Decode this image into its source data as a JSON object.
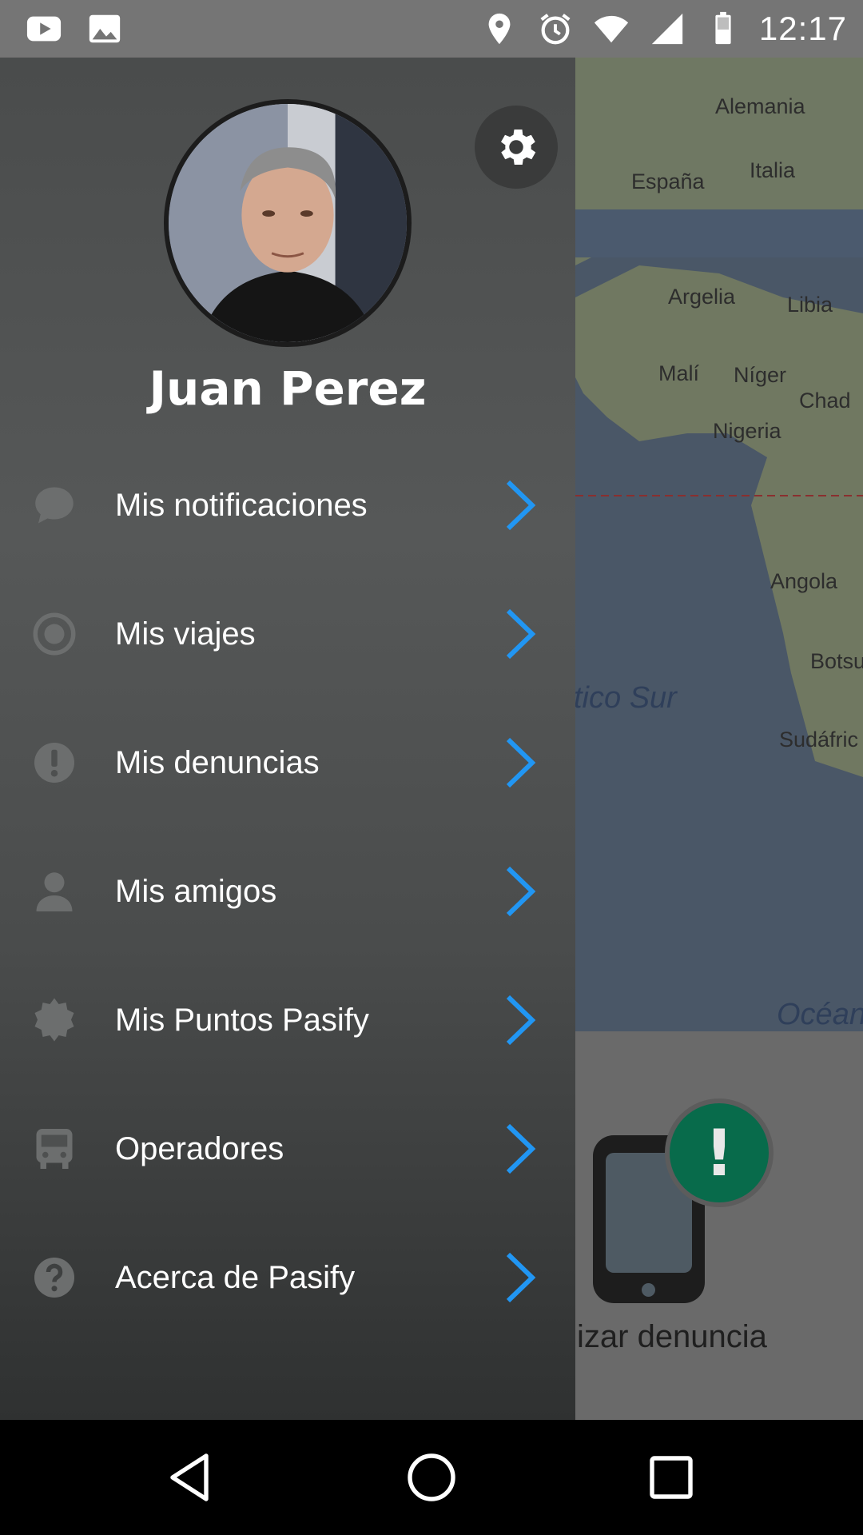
{
  "status_bar": {
    "time": "12:17",
    "left_icons": [
      "youtube-icon",
      "image-icon"
    ],
    "right_icons": [
      "location-icon",
      "alarm-icon",
      "wifi-icon",
      "signal-icon",
      "battery-icon"
    ]
  },
  "map": {
    "labels": [
      "Alemania",
      "España",
      "Italia",
      "Argelia",
      "Libia",
      "Malí",
      "Níger",
      "Chad",
      "Nigeria",
      "Angola",
      "Botsu",
      "Sudáfric"
    ],
    "ocean_labels": [
      "tico Sur",
      "Océan"
    ]
  },
  "background_panel": {
    "report_label": "izar denuncia"
  },
  "drawer": {
    "user_name": "Juan Perez",
    "menu_items": [
      {
        "label": "Mis notificaciones",
        "icon": "chat-bubble-icon"
      },
      {
        "label": "Mis viajes",
        "icon": "radio-target-icon"
      },
      {
        "label": "Mis denuncias",
        "icon": "alert-icon"
      },
      {
        "label": "Mis amigos",
        "icon": "person-icon"
      },
      {
        "label": "Mis Puntos Pasify",
        "icon": "badge-icon"
      },
      {
        "label": "Operadores",
        "icon": "bus-icon"
      },
      {
        "label": "Acerca de Pasify",
        "icon": "help-icon"
      }
    ]
  },
  "colors": {
    "accent": "#2196f3",
    "status_bar": "#757575",
    "drawer": "#505252",
    "bubble": "#086b4b"
  }
}
